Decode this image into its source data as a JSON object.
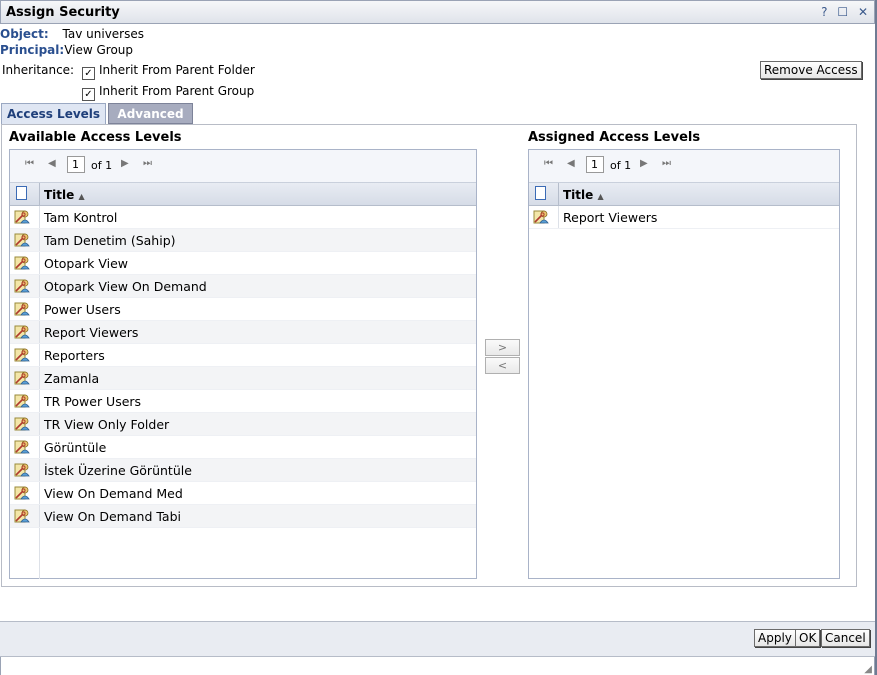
{
  "window": {
    "title": "Assign Security",
    "help": "?",
    "maximize": "☐",
    "close": "✕"
  },
  "info": {
    "object_label": "Object:",
    "object_value": "Tav universes",
    "principal_label": "Principal:",
    "principal_value": "View Group",
    "inheritance_label": "Inheritance:",
    "inherit_folder": {
      "label": "Inherit From Parent Folder",
      "checked": true
    },
    "inherit_group": {
      "label": "Inherit From Parent Group",
      "checked": true
    },
    "remove_access": "Remove Access"
  },
  "tabs": [
    {
      "label": "Access Levels",
      "active": true
    },
    {
      "label": "Advanced",
      "active": false
    }
  ],
  "available": {
    "title": "Available Access Levels",
    "page": "1",
    "of": "of 1",
    "column": "Title",
    "sort": "▲",
    "items": [
      "Tam Kontrol",
      "Tam Denetim (Sahip)",
      "Otopark View",
      "Otopark View On Demand",
      "Power Users",
      "Report Viewers",
      "Reporters",
      "Zamanla",
      "TR Power Users",
      "TR View Only Folder",
      "Görüntüle",
      "İstek Üzerine Görüntüle",
      "View On Demand Med",
      "View On Demand Tabi"
    ]
  },
  "assigned": {
    "title": "Assigned Access Levels",
    "page": "1",
    "of": "of 1",
    "column": "Title",
    "sort": "▲",
    "items": [
      "Report Viewers"
    ]
  },
  "move": {
    "add": ">",
    "remove": "<"
  },
  "pager_icons": {
    "first": "⏮",
    "prev": "◀",
    "next": "▶",
    "last": "⏭"
  },
  "footer": {
    "apply": "Apply",
    "ok": "OK",
    "cancel": "Cancel"
  },
  "colors": {
    "accent": "#2a4f8f",
    "tab_inactive": "#a7acbf"
  }
}
